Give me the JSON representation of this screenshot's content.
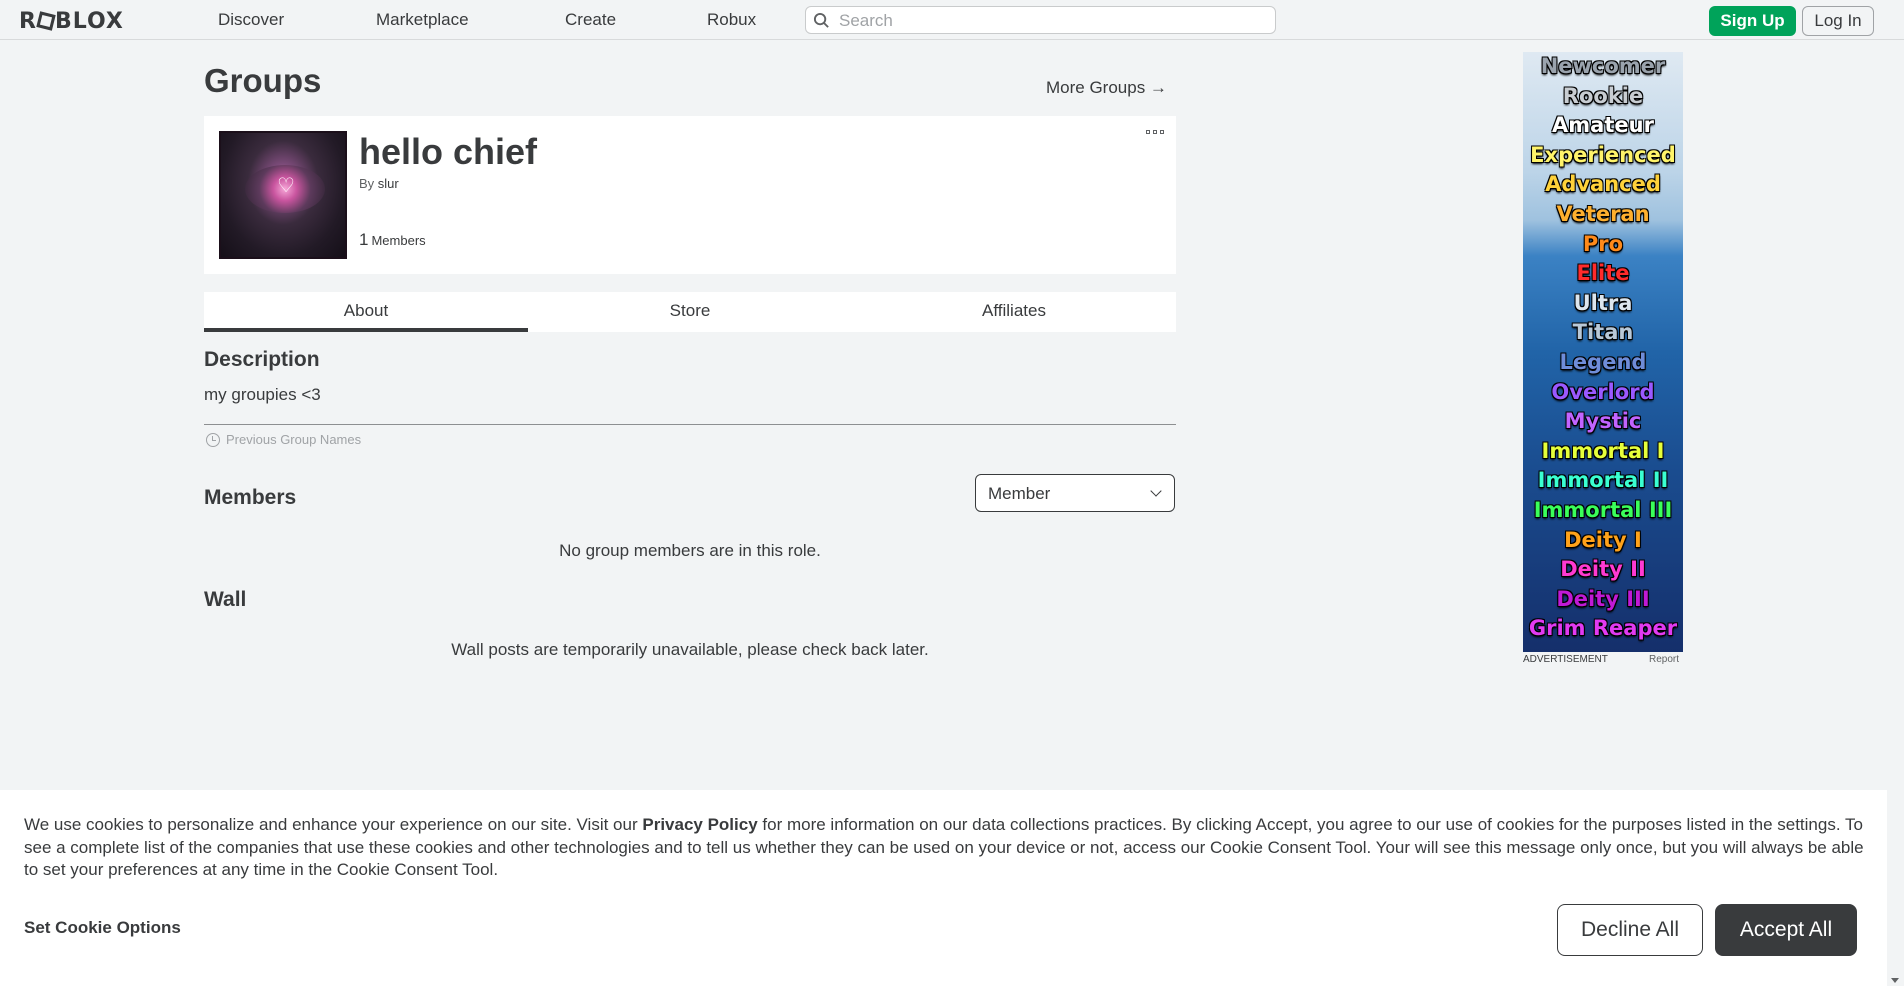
{
  "nav": {
    "logo": "ROBLOX",
    "links": [
      "Discover",
      "Marketplace",
      "Create",
      "Robux"
    ],
    "search_placeholder": "Search",
    "signup": "Sign Up",
    "login": "Log In"
  },
  "page": {
    "title": "Groups",
    "more_groups": "More Groups →"
  },
  "group": {
    "name": "hello chief",
    "by_label": "By",
    "owner": "slur",
    "member_count": "1",
    "members_label": "Members"
  },
  "tabs": [
    "About",
    "Store",
    "Affiliates"
  ],
  "about": {
    "description_title": "Description",
    "description": "my groupies <3",
    "previous_names": "Previous Group Names",
    "members_title": "Members",
    "role_selected": "Member",
    "members_empty": "No group members are in this role.",
    "wall_title": "Wall",
    "wall_empty": "Wall posts are temporarily unavailable, please check back later."
  },
  "ad": {
    "tiers": [
      {
        "label": "Newcomer",
        "color": "#9aa3ad"
      },
      {
        "label": "Rookie",
        "color": "#c8cdd2"
      },
      {
        "label": "Amateur",
        "color": "#ffffff"
      },
      {
        "label": "Experienced",
        "color": "#fff46a"
      },
      {
        "label": "Advanced",
        "color": "#ffd23a"
      },
      {
        "label": "Veteran",
        "color": "#ffb02e"
      },
      {
        "label": "Pro",
        "color": "#ff8a1a"
      },
      {
        "label": "Elite",
        "color": "#ff2b2b"
      },
      {
        "label": "Ultra",
        "color": "#dde6ee"
      },
      {
        "label": "Titan",
        "color": "#b9c9d8"
      },
      {
        "label": "Legend",
        "color": "#6f8dd9"
      },
      {
        "label": "Overlord",
        "color": "#9b59ff"
      },
      {
        "label": "Mystic",
        "color": "#c164ff"
      },
      {
        "label": "Immortal I",
        "color": "#e6ff3a"
      },
      {
        "label": "Immortal II",
        "color": "#3affd2"
      },
      {
        "label": "Immortal III",
        "color": "#3aff5a"
      },
      {
        "label": "Deity I",
        "color": "#ffa21a"
      },
      {
        "label": "Deity II",
        "color": "#ff3ad2"
      },
      {
        "label": "Deity III",
        "color": "#c01ad6"
      },
      {
        "label": "Grim Reaper",
        "color": "#e23af2"
      }
    ],
    "label": "ADVERTISEMENT",
    "report": "Report"
  },
  "cookie": {
    "text_before": "We use cookies to personalize and enhance your experience on our site. Visit our ",
    "privacy_link": "Privacy Policy",
    "text_after": " for more information on our data collections practices. By clicking Accept, you agree to our use of cookies for the purposes listed in the settings. To see a complete list of the companies that use these cookies and other technologies and to tell us whether they can be used on your device or not, access our Cookie Consent Tool. Your will see this message only once, but you will always be able to set your preferences at any time in the Cookie Consent Tool.",
    "set_options": "Set Cookie Options",
    "decline": "Decline All",
    "accept": "Accept All"
  }
}
